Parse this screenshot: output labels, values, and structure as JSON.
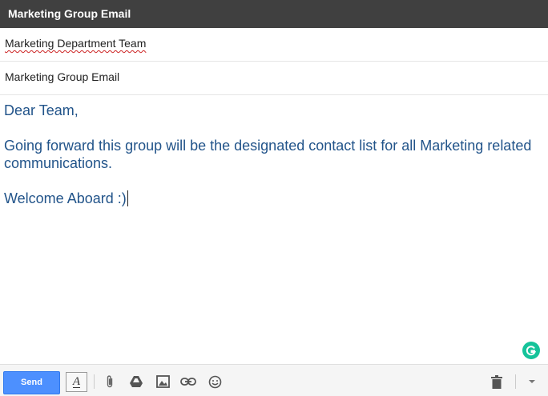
{
  "window": {
    "title": "Marketing Group Email"
  },
  "recipients": {
    "value": "Marketing Department Team"
  },
  "subject": {
    "value": "Marketing Group Email"
  },
  "body": {
    "greeting": "Dear Team,",
    "paragraph": "Going forward this group will be the designated contact list for all Marketing related communications.",
    "closing": "Welcome Aboard :)"
  },
  "toolbar": {
    "send_label": "Send",
    "format_label": "A",
    "icons": [
      "formatting-icon",
      "attach-icon",
      "drive-icon",
      "photo-icon",
      "link-icon",
      "emoji-icon",
      "trash-icon",
      "more-options-icon"
    ]
  },
  "colors": {
    "title_bar": "#404040",
    "body_text": "#22548a",
    "send_button": "#4d90fe",
    "grammarly": "#15c39a"
  }
}
